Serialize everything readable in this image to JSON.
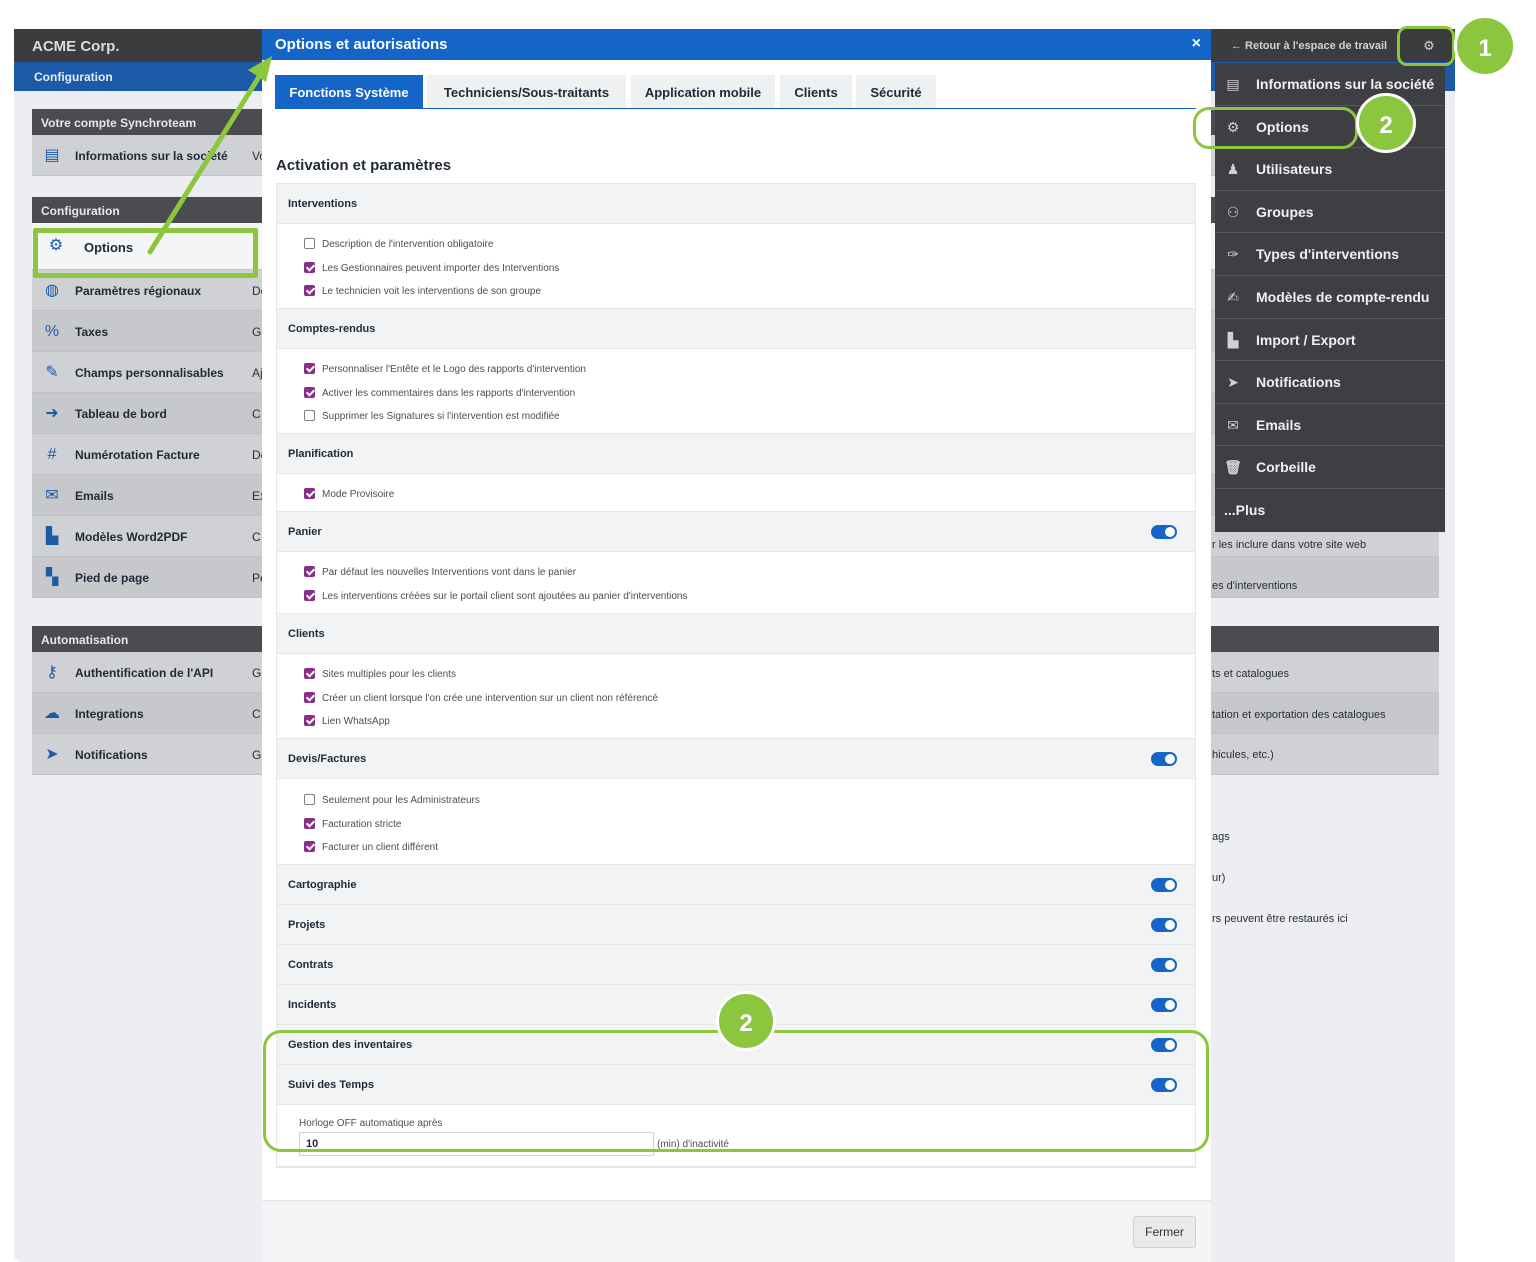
{
  "app": {
    "company": "ACME Corp.",
    "section": "Configuration"
  },
  "panels": {
    "account": {
      "title": "Votre compte Synchroteam",
      "rows": [
        {
          "label": "Informations sur la société",
          "desc": "Vo",
          "icon": "id-card-icon"
        }
      ]
    },
    "config": {
      "title": "Configuration",
      "rows": [
        {
          "label": "Options",
          "desc": "",
          "icon": "gear-icon"
        },
        {
          "label": "Paramètres régionaux",
          "desc": "De",
          "icon": "globe-icon"
        },
        {
          "label": "Taxes",
          "desc": "G",
          "icon": "percent-icon"
        },
        {
          "label": "Champs personnalisables",
          "desc": "Aj",
          "icon": "edit-icon"
        },
        {
          "label": "Tableau de bord",
          "desc": "C",
          "icon": "file-export-icon"
        },
        {
          "label": "Numérotation Facture",
          "desc": "De",
          "icon": "hash-icon"
        },
        {
          "label": "Emails",
          "desc": "Ex",
          "icon": "envelope-icon"
        },
        {
          "label": "Modèles Word2PDF",
          "desc": "C",
          "icon": "pdf-icon"
        },
        {
          "label": "Pied de page",
          "desc": "Pe",
          "icon": "file-code-icon"
        }
      ]
    },
    "automation": {
      "title": "Automatisation",
      "rows": [
        {
          "label": "Authentification de l'API",
          "desc": "G",
          "icon": "key-icon"
        },
        {
          "label": "Integrations",
          "desc": "C",
          "icon": "cloud-icon"
        },
        {
          "label": "Notifications",
          "desc": "G",
          "icon": "paper-plane-icon"
        }
      ]
    }
  },
  "right_descs": [
    "r les inclure dans votre site web",
    "es d'interventions",
    "ts et catalogues",
    "tation et exportation des catalogues",
    "hicules, etc.)",
    "ags",
    "ur)",
    "rs peuvent être restaurés ici"
  ],
  "modal": {
    "title": "Options et autorisations",
    "close_icon": "×",
    "close_button": "Fermer",
    "section_title": "Activation et paramètres",
    "tabs": [
      {
        "label": "Fonctions Système",
        "active": true
      },
      {
        "label": "Techniciens/Sous-traitants",
        "active": false
      },
      {
        "label": "Application mobile",
        "active": false
      },
      {
        "label": "Clients",
        "active": false
      },
      {
        "label": "Sécurité",
        "active": false
      }
    ],
    "groups": [
      {
        "title": "Interventions",
        "toggle": false,
        "items": [
          {
            "label": "Description de l'intervention obligatoire",
            "checked": false
          },
          {
            "label": "Les Gestionnaires peuvent importer des Interventions",
            "checked": true
          },
          {
            "label": "Le technicien voit les interventions de son groupe",
            "checked": true
          }
        ]
      },
      {
        "title": "Comptes-rendus",
        "toggle": false,
        "items": [
          {
            "label": "Personnaliser l'Entête et le Logo des rapports d'intervention",
            "checked": true
          },
          {
            "label": "Activer les commentaires dans les rapports d'intervention",
            "checked": true
          },
          {
            "label": "Supprimer les Signatures si l'intervention est modifiée",
            "checked": false
          }
        ]
      },
      {
        "title": "Planification",
        "toggle": false,
        "items": [
          {
            "label": "Mode Provisoire",
            "checked": true
          }
        ]
      },
      {
        "title": "Panier",
        "toggle": true,
        "items": [
          {
            "label": "Par défaut les nouvelles Interventions vont dans le panier",
            "checked": true
          },
          {
            "label": "Les interventions créées sur le portail client sont ajoutées au panier d'interventions",
            "checked": true
          }
        ]
      },
      {
        "title": "Clients",
        "toggle": false,
        "items": [
          {
            "label": "Sites multiples pour les clients",
            "checked": true
          },
          {
            "label": "Créer un client lorsque l'on crée une intervention sur un client non référencé",
            "checked": true
          },
          {
            "label": "Lien WhatsApp",
            "checked": true
          }
        ]
      },
      {
        "title": "Devis/Factures",
        "toggle": true,
        "items": [
          {
            "label": "Seulement pour les Administrateurs",
            "checked": false
          },
          {
            "label": "Facturation stricte",
            "checked": true
          },
          {
            "label": "Facturer un client différent",
            "checked": true
          }
        ]
      },
      {
        "title": "Cartographie",
        "toggle": true,
        "items": []
      },
      {
        "title": "Projets",
        "toggle": true,
        "items": []
      },
      {
        "title": "Contrats",
        "toggle": true,
        "items": []
      },
      {
        "title": "Incidents",
        "toggle": true,
        "items": []
      },
      {
        "title": "Gestion des inventaires",
        "toggle": true,
        "items": []
      },
      {
        "title": "Suivi des Temps",
        "toggle": true,
        "items": []
      }
    ],
    "timer": {
      "label": "Horloge OFF automatique après",
      "value": "10",
      "unit": "(min) d'inactivité"
    }
  },
  "dropdown": {
    "back_link": "← Retour à l'espace de travail",
    "items": [
      {
        "label": "Informations sur la société",
        "icon": "id-card-icon"
      },
      {
        "label": "Options",
        "icon": "gear-icon"
      },
      {
        "label": "Utilisateurs",
        "icon": "user-edit-icon"
      },
      {
        "label": "Groupes",
        "icon": "users-icon"
      },
      {
        "label": "Types d'interventions",
        "icon": "wrench-icon"
      },
      {
        "label": "Modèles de compte-rendu",
        "icon": "file-signature-icon"
      },
      {
        "label": "Import / Export",
        "icon": "csv-file-icon"
      },
      {
        "label": "Notifications",
        "icon": "paper-plane-icon"
      },
      {
        "label": "Emails",
        "icon": "envelope-icon"
      },
      {
        "label": "Corbeille",
        "icon": "trash-icon"
      },
      {
        "label": "...Plus",
        "icon": ""
      }
    ]
  },
  "annotations": {
    "badge1": "1",
    "badge2a": "2",
    "badge2b": "2",
    "accent": "#8cc63f"
  }
}
